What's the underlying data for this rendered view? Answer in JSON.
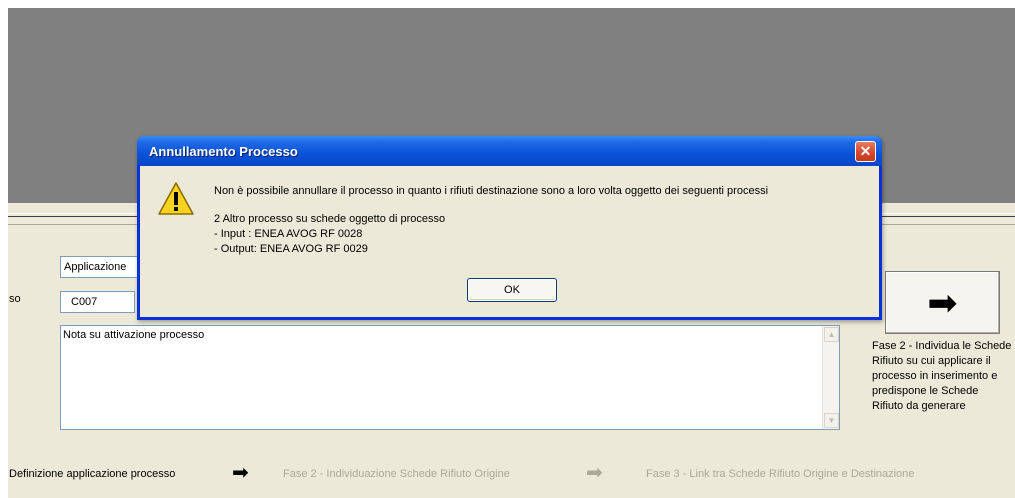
{
  "background": {
    "color": "#808080"
  },
  "form": {
    "application_value": "Applicazione",
    "code_label": "so",
    "code_value": "C007",
    "note_text": "Nota su attivazione processo",
    "next_button_icon": "arrow-right-icon",
    "phase2_description": "Fase 2 - Individua le Schede Rifiuto su cui applicare il processo in inserimento e predispone le Schede Rifiuto da generare"
  },
  "steps": [
    {
      "label": "Definizione applicazione processo",
      "active": true
    },
    {
      "label": "Fase 2 - Individuazione Schede Rifiuto Origine",
      "active": false
    },
    {
      "label": "Fase 3 - Link tra Schede Rifiuto Origine e Destinazione",
      "active": false
    }
  ],
  "dialog": {
    "title": "Annullamento Processo",
    "close_glyph": "✕",
    "icon": "warning-icon",
    "message_line1": "Non è possibile annullare il processo in quanto i rifiuti destinazione sono a loro volta oggetto dei seguenti processi",
    "message_line2": "2 Altro processo su schede oggetto di processo",
    "message_line3": "- Input  : ENEA AVOG RF 0028",
    "message_line4": "- Output: ENEA AVOG RF 0029",
    "ok_label": "OK"
  },
  "colors": {
    "titlebar": "#0a52d8",
    "dialog_bg": "#ece9d8",
    "disabled_text": "#aca899"
  }
}
